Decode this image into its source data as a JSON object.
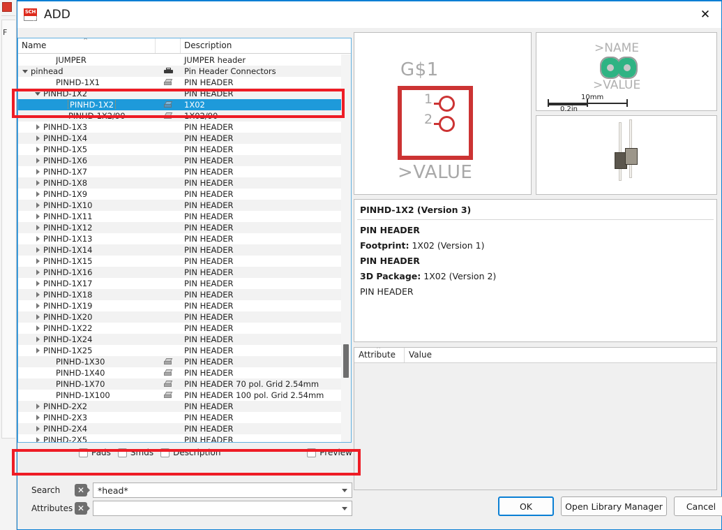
{
  "window": {
    "title": "ADD",
    "icon": "schematic-sheet-icon",
    "icon_tag": "SCH",
    "close_label": "✕",
    "accent_color": "#0a7fd4"
  },
  "tree": {
    "columns": [
      "Name",
      "",
      "Description"
    ],
    "sort_indicator": "⌃",
    "rows": [
      {
        "indent": 2,
        "arrow": "none",
        "name": "JUMPER",
        "icon": "",
        "desc": "JUMPER header",
        "selected": false
      },
      {
        "indent": 0,
        "arrow": "down",
        "name": "pinhead",
        "icon": "printer",
        "desc": "Pin Header Connectors",
        "selected": false
      },
      {
        "indent": 2,
        "arrow": "none",
        "name": "PINHD-1X1",
        "icon": "pkg3d",
        "desc": "PIN HEADER",
        "selected": false
      },
      {
        "indent": 1,
        "arrow": "down",
        "name": "PINHD-1X2",
        "icon": "",
        "desc": "PIN HEADER",
        "selected": false
      },
      {
        "indent": 3,
        "arrow": "none",
        "name": "PINHD-1X2",
        "icon": "pkg3d",
        "desc": "1X02",
        "selected": true
      },
      {
        "indent": 3,
        "arrow": "none",
        "name": "PINHD-1X2/90",
        "icon": "pkg3d",
        "desc": "1X02/90",
        "selected": false
      },
      {
        "indent": 1,
        "arrow": "right",
        "name": "PINHD-1X3",
        "icon": "",
        "desc": "PIN HEADER",
        "selected": false
      },
      {
        "indent": 1,
        "arrow": "right",
        "name": "PINHD-1X4",
        "icon": "",
        "desc": "PIN HEADER",
        "selected": false
      },
      {
        "indent": 1,
        "arrow": "right",
        "name": "PINHD-1X5",
        "icon": "",
        "desc": "PIN HEADER",
        "selected": false
      },
      {
        "indent": 1,
        "arrow": "right",
        "name": "PINHD-1X6",
        "icon": "",
        "desc": "PIN HEADER",
        "selected": false
      },
      {
        "indent": 1,
        "arrow": "right",
        "name": "PINHD-1X7",
        "icon": "",
        "desc": "PIN HEADER",
        "selected": false
      },
      {
        "indent": 1,
        "arrow": "right",
        "name": "PINHD-1X8",
        "icon": "",
        "desc": "PIN HEADER",
        "selected": false
      },
      {
        "indent": 1,
        "arrow": "right",
        "name": "PINHD-1X9",
        "icon": "",
        "desc": "PIN HEADER",
        "selected": false
      },
      {
        "indent": 1,
        "arrow": "right",
        "name": "PINHD-1X10",
        "icon": "",
        "desc": "PIN HEADER",
        "selected": false
      },
      {
        "indent": 1,
        "arrow": "right",
        "name": "PINHD-1X11",
        "icon": "",
        "desc": "PIN HEADER",
        "selected": false
      },
      {
        "indent": 1,
        "arrow": "right",
        "name": "PINHD-1X12",
        "icon": "",
        "desc": "PIN HEADER",
        "selected": false
      },
      {
        "indent": 1,
        "arrow": "right",
        "name": "PINHD-1X13",
        "icon": "",
        "desc": "PIN HEADER",
        "selected": false
      },
      {
        "indent": 1,
        "arrow": "right",
        "name": "PINHD-1X14",
        "icon": "",
        "desc": "PIN HEADER",
        "selected": false
      },
      {
        "indent": 1,
        "arrow": "right",
        "name": "PINHD-1X15",
        "icon": "",
        "desc": "PIN HEADER",
        "selected": false
      },
      {
        "indent": 1,
        "arrow": "right",
        "name": "PINHD-1X16",
        "icon": "",
        "desc": "PIN HEADER",
        "selected": false
      },
      {
        "indent": 1,
        "arrow": "right",
        "name": "PINHD-1X17",
        "icon": "",
        "desc": "PIN HEADER",
        "selected": false
      },
      {
        "indent": 1,
        "arrow": "right",
        "name": "PINHD-1X18",
        "icon": "",
        "desc": "PIN HEADER",
        "selected": false
      },
      {
        "indent": 1,
        "arrow": "right",
        "name": "PINHD-1X19",
        "icon": "",
        "desc": "PIN HEADER",
        "selected": false
      },
      {
        "indent": 1,
        "arrow": "right",
        "name": "PINHD-1X20",
        "icon": "",
        "desc": "PIN HEADER",
        "selected": false
      },
      {
        "indent": 1,
        "arrow": "right",
        "name": "PINHD-1X22",
        "icon": "",
        "desc": "PIN HEADER",
        "selected": false
      },
      {
        "indent": 1,
        "arrow": "right",
        "name": "PINHD-1X24",
        "icon": "",
        "desc": "PIN HEADER",
        "selected": false
      },
      {
        "indent": 1,
        "arrow": "right",
        "name": "PINHD-1X25",
        "icon": "",
        "desc": "PIN HEADER",
        "selected": false
      },
      {
        "indent": 2,
        "arrow": "none",
        "name": "PINHD-1X30",
        "icon": "pkg3d",
        "desc": "PIN HEADER",
        "selected": false
      },
      {
        "indent": 2,
        "arrow": "none",
        "name": "PINHD-1X40",
        "icon": "pkg3d",
        "desc": "PIN HEADER",
        "selected": false
      },
      {
        "indent": 2,
        "arrow": "none",
        "name": "PINHD-1X70",
        "icon": "pkg3d",
        "desc": "PIN HEADER 70 pol. Grid 2.54mm",
        "selected": false
      },
      {
        "indent": 2,
        "arrow": "none",
        "name": "PINHD-1X100",
        "icon": "pkg3d",
        "desc": "PIN HEADER 100 pol. Grid 2.54mm",
        "selected": false
      },
      {
        "indent": 1,
        "arrow": "right",
        "name": "PINHD-2X2",
        "icon": "",
        "desc": "PIN HEADER",
        "selected": false
      },
      {
        "indent": 1,
        "arrow": "right",
        "name": "PINHD-2X3",
        "icon": "",
        "desc": "PIN HEADER",
        "selected": false
      },
      {
        "indent": 1,
        "arrow": "right",
        "name": "PINHD-2X4",
        "icon": "",
        "desc": "PIN HEADER",
        "selected": false
      },
      {
        "indent": 1,
        "arrow": "right",
        "name": "PINHD-2X5",
        "icon": "",
        "desc": "PIN HEADER",
        "selected": false
      }
    ]
  },
  "filters": {
    "pads": "Pads",
    "smds": "Smds",
    "description": "Description",
    "preview": "Preview"
  },
  "search": {
    "label": "Search",
    "value": "*head*",
    "clear_glyph": "✕"
  },
  "attributes_filter": {
    "label": "Attributes",
    "value": "",
    "clear_glyph": "✕"
  },
  "symbol_preview": {
    "name_text": "G$1",
    "value_text": ">VALUE",
    "pin1": "1",
    "pin2": "2",
    "outline_color": "#cc3333"
  },
  "footprint_preview": {
    "name_text": ">NAME",
    "value_text": ">VALUE",
    "scale_mm": "10mm",
    "scale_in": "0.2in",
    "pad_color": "#2fb383"
  },
  "details": {
    "title": "PINHD-1X2 (Version 3)",
    "device_desc": "PIN HEADER",
    "footprint_label": "Footprint:",
    "footprint_value": "1X02 (Version 1)",
    "footprint_desc": "PIN HEADER",
    "package3d_label": "3D Package:",
    "package3d_value": "1X02 (Version 2)",
    "package3d_desc": "PIN HEADER"
  },
  "attributes_table": {
    "columns": [
      "Attribute",
      "Value"
    ],
    "sort_indicator": "⌃",
    "rows": []
  },
  "buttons": {
    "ok": "OK",
    "open_library_manager": "Open Library Manager",
    "cancel": "Cancel"
  },
  "annotations": {
    "highlight_color": "#ee1c25",
    "boxes": [
      "selected-tree-row",
      "search-field"
    ]
  }
}
